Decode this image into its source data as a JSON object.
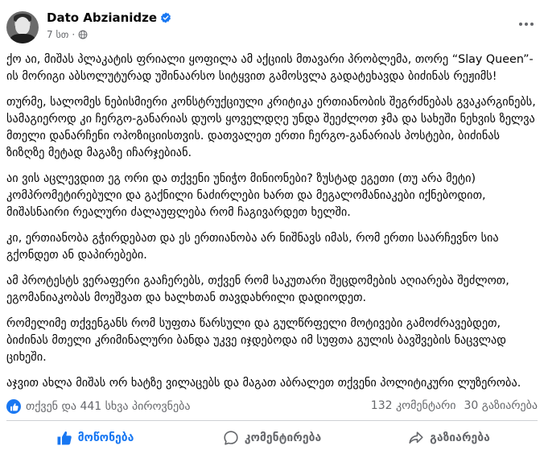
{
  "post": {
    "author": "Dato Abzianidze",
    "time": "7 სთ",
    "paragraphs": [
      "ქო აი, მიშას პლაკატის ფრიალი ყოფილა ამ აქციის მთავარი პრობლემა, თორე “Slay Queen”-ის მორიგი აბსოლუტურად უშინაარსო სიტყვით გამოსვლა გადატეხავდა ბიძინას რეჟიმს!",
      "თურმე, სალომეს ნებისმიერი კონსტრუქციული კრიტიკა ერთიანობის შეგრძნებას გვაკარგინებს, სამაგიეროდ კი ჩერგო-განარიას დუოს ყოველდღე უნდა შეეძლოთ ჯმა და სახეში ნეხვის ზელვა მთელი დანარჩენი ოპოზიციისთვის. დათვალეთ ერთი ჩერგო-განარიას პოსტები, ბიძინას ზიზღზე მეტად მაგაზე იჩარჯებიან.",
      "აი ვის აცლევდით ეგ ორი და თქვენი უნიჭო მინიონები? ზუსტად ეგეთი (თუ არა მეტი) კომპრომეტირებული და გაქნილი ნაძირლები ხართ და მეგალომანიაკები იქნებოდით, მიშასნაირი რეალური ძალაუფლება რომ ჩაგივარდეთ ხელში.",
      "კი, ერთიანობა გჭირდებათ და ეს ერთიანობა არ ნიშნავს იმას, რომ ერთი საარჩევნო სია გქონდეთ ან დაპირებები.",
      "ამ პროტესტს ვერაფერი გააჩერებს, თქვენ რომ საკუთარი შეცდომების აღიარება შეძლოთ, ეგომანიაკობას მოეშვათ და ხალხთან თავდახრილი დადიოდეთ.",
      "რომელიმე თქვენგანს რომ სუფთა წარსული და გულწრფელი მოტივები გამოძრავებდეთ, ბიძინას მთელი კრიმინალური ბანდა უკვე იჯდებოდა იმ სუფთა გულის ბავშვების ნაცვლად ციხეში.",
      "აჯვით ახლა მიშას ორ ხატზე ვილაცებს და მაგათ აბრალეთ თქვენი პოლიტიკური ლუზერობა."
    ]
  },
  "stats": {
    "reactions_text": "თქვენ და 441 სხვა პიროვნება",
    "comments": "132 კომენტარი",
    "shares": "30 გაზიარება"
  },
  "actions": {
    "like": "მოწონება",
    "comment": "კომენტირება",
    "share": "გაზიარება"
  },
  "colors": {
    "accent": "#1877f2",
    "secondary_text": "#65676b"
  },
  "icons": [
    "verified-badge-icon",
    "globe-icon",
    "more-icon",
    "like-icon",
    "comment-icon",
    "share-icon"
  ]
}
